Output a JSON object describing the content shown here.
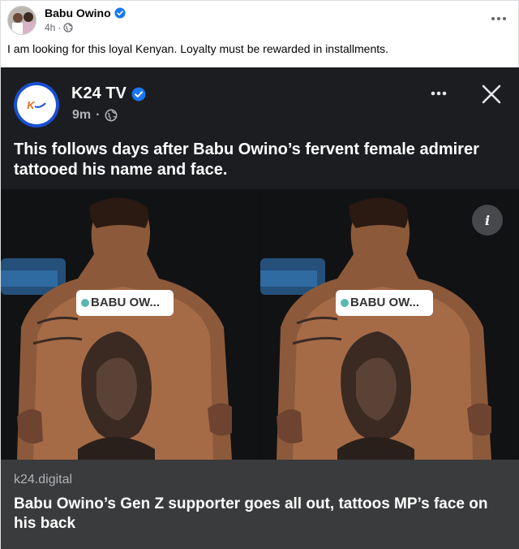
{
  "post": {
    "author": "Babu Owino",
    "time": "4h",
    "separator": "·",
    "caption": "I am looking for this loyal Kenyan. Loyalty must be rewarded in installments.",
    "more_icon": "more-dots-icon"
  },
  "shared": {
    "page_name": "K24 TV",
    "logo_text": "K",
    "time": "9m",
    "separator": "·",
    "text": "This follows days after Babu Owino’s fervent female admirer tattooed his name and face.",
    "image_tag": "BABU OW...",
    "info_label": "i",
    "link_domain": "k24.digital",
    "link_headline": "Babu Owino’s Gen Z supporter goes all out, tattoos MP’s face on his back"
  },
  "colors": {
    "verified_blue": "#1877f2",
    "card_dark": "#1b1d20",
    "link_bg": "#3a3b3c",
    "k24_ring": "#1a4fd1",
    "k24_orange": "#e56a1a"
  }
}
